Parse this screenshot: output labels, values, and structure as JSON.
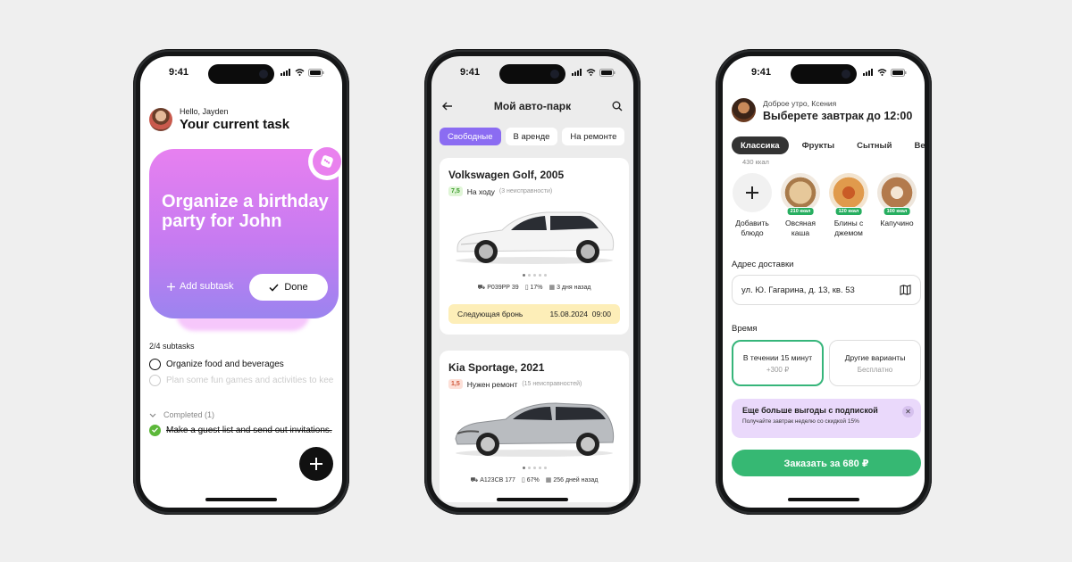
{
  "colors": {
    "background": "#efefef",
    "task_gradient_top": "#e780f0",
    "task_gradient_bottom": "#9b84ef",
    "chip_active": "#8b6cf2",
    "order_green": "#36b873",
    "promo_bg": "#ead9fb"
  },
  "phones": [
    {
      "time": "9:41",
      "greeting": "Hello, Jayden",
      "title": "Your current task",
      "task": "Organize a birthday party for John",
      "add_subtask": "Add subtask",
      "done": "Done",
      "subtasks_count": "2/4 subtasks",
      "todos": [
        "Organize food and beverages",
        "Plan some fun games and activities to keep"
      ],
      "completed_label": "Completed (1)",
      "completed_items": [
        "Make a guest list and send out invitations."
      ],
      "icons": [
        "dice-icon",
        "plus-icon",
        "check-icon",
        "chevron-down-icon"
      ]
    },
    {
      "time": "9:41",
      "title": "Мой авто-парк",
      "chips": [
        "Свободные",
        "В аренде",
        "На ремонте"
      ],
      "cars": [
        {
          "name": "Volkswagen Golf, 2005",
          "score": "7,5",
          "status": "На ходу",
          "status_note": "(3 неисправности)",
          "plate": "Р039РР 39",
          "fuel": "17%",
          "ago": "3 дня назад",
          "booking_label": "Следующая бронь",
          "booking_date": "15.08.2024",
          "booking_time": "09:00"
        },
        {
          "name": "Kia Sportage, 2021",
          "score": "1,5",
          "status": "Нужен ремонт",
          "status_note": "(15 неисправностей)",
          "plate": "А123СВ 177",
          "fuel": "67%",
          "ago": "256 дней назад"
        }
      ]
    },
    {
      "time": "9:41",
      "greeting": "Доброе утро, Ксения",
      "title": "Выберете завтрак до 12:00",
      "tabs": [
        "Классика",
        "Фрукты",
        "Сытный",
        "Веган"
      ],
      "kcal_hint": "430 ккал",
      "foods": [
        {
          "label": "Добавить блюдо",
          "kcal": ""
        },
        {
          "label": "Овсяная каша",
          "kcal": "210 ккал"
        },
        {
          "label": "Блины с джемом",
          "kcal": "120 ккал"
        },
        {
          "label": "Капучино",
          "kcal": "100 ккал"
        }
      ],
      "address_label": "Адрес доставки",
      "address": "ул. Ю. Гагарина, д. 13, кв. 53",
      "time_label": "Время",
      "time_options": [
        {
          "title": "В течении 15 минут",
          "sub": "+300 ₽"
        },
        {
          "title": "Другие варианты",
          "sub": "Бесплатно"
        }
      ],
      "promo_title": "Еще больше выгоды с подпиской",
      "promo_sub": "Получайте завтрак неделю со скидкой 15%",
      "order": "Заказать за 680 ₽"
    }
  ]
}
